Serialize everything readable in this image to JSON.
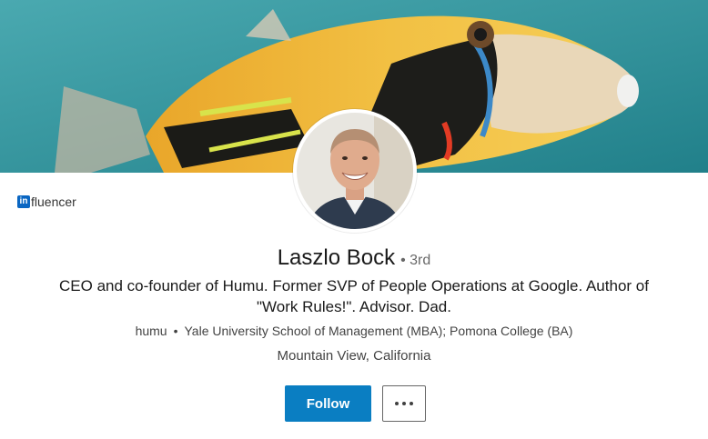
{
  "profile": {
    "influencer_badge": "in",
    "influencer_suffix": "fluencer",
    "name": "Laszlo Bock",
    "degree": "• 3rd",
    "headline": "CEO and co-founder of Humu. Former SVP of People Operations at Google. Author of \"Work Rules!\". Advisor. Dad.",
    "company": "humu",
    "separator": "•",
    "education": "Yale University School of Management (MBA); Pomona College (BA)",
    "location": "Mountain View, California"
  },
  "actions": {
    "follow_label": "Follow",
    "more_icon": "more-horizontal-icon"
  },
  "colors": {
    "follow_bg": "#0a7ec2",
    "influencer_logo": "#0a66c2",
    "banner_water": "#2f8e97"
  }
}
